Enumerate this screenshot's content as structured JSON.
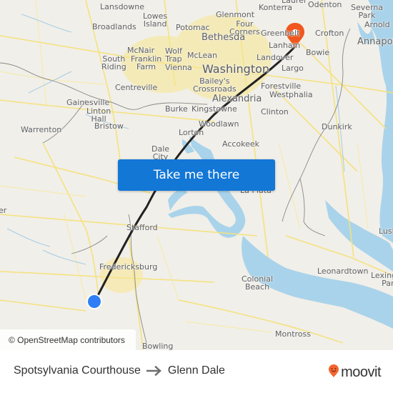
{
  "map": {
    "places": [
      {
        "name": "Lansdowne",
        "size": "normal"
      },
      {
        "name": "Broadlands",
        "size": "normal"
      },
      {
        "name": "Lowes\nIsland",
        "size": "normal"
      },
      {
        "name": "Potomac",
        "size": "normal"
      },
      {
        "name": "Glenmont",
        "size": "normal"
      },
      {
        "name": "Laurel",
        "size": "normal"
      },
      {
        "name": "Konterra",
        "size": "normal"
      },
      {
        "name": "Odenton",
        "size": "normal"
      },
      {
        "name": "Severna\nPark",
        "size": "normal"
      },
      {
        "name": "Arnold",
        "size": "normal"
      },
      {
        "name": "Annapolis",
        "size": "mid"
      },
      {
        "name": "Four\nCorners",
        "size": "normal"
      },
      {
        "name": "Bethesda",
        "size": "mid"
      },
      {
        "name": "Greenbelt",
        "size": "normal"
      },
      {
        "name": "Lanham",
        "size": "normal"
      },
      {
        "name": "Crofton",
        "size": "normal"
      },
      {
        "name": "Bowie",
        "size": "normal"
      },
      {
        "name": "McNair",
        "size": "normal"
      },
      {
        "name": "Franklin\nFarm",
        "size": "normal"
      },
      {
        "name": "Wolf\nTrap",
        "size": "normal"
      },
      {
        "name": "Vienna",
        "size": "normal"
      },
      {
        "name": "McLean",
        "size": "normal"
      },
      {
        "name": "South\nRiding",
        "size": "normal"
      },
      {
        "name": "Washington",
        "size": "big"
      },
      {
        "name": "Landover",
        "size": "normal"
      },
      {
        "name": "Largo",
        "size": "normal"
      },
      {
        "name": "Centreville",
        "size": "normal"
      },
      {
        "name": "Bailey's\nCrossroads",
        "size": "normal"
      },
      {
        "name": "Alexandria",
        "size": "mid"
      },
      {
        "name": "Forestville",
        "size": "normal"
      },
      {
        "name": "Westphalia",
        "size": "normal"
      },
      {
        "name": "Gainesville",
        "size": "normal"
      },
      {
        "name": "Linton\nHall",
        "size": "normal"
      },
      {
        "name": "Burke",
        "size": "normal"
      },
      {
        "name": "Kingstowne",
        "size": "normal"
      },
      {
        "name": "Clinton",
        "size": "normal"
      },
      {
        "name": "Warrenton",
        "size": "normal"
      },
      {
        "name": "Bristow",
        "size": "normal"
      },
      {
        "name": "Woodlawn",
        "size": "normal"
      },
      {
        "name": "Lorton",
        "size": "normal"
      },
      {
        "name": "Dunkirk",
        "size": "normal"
      },
      {
        "name": "Accokeek",
        "size": "normal"
      },
      {
        "name": "Dale\nCity",
        "size": "normal"
      },
      {
        "name": "La Plata",
        "size": "normal"
      },
      {
        "name": "Stafford",
        "size": "normal"
      },
      {
        "name": "Lusby",
        "size": "normal"
      },
      {
        "name": "Fredericksburg",
        "size": "normal"
      },
      {
        "name": "Leonardtown",
        "size": "normal"
      },
      {
        "name": "Lexington\nPark",
        "size": "normal"
      },
      {
        "name": "Colonial\nBeach",
        "size": "normal"
      },
      {
        "name": "Montross",
        "size": "normal"
      },
      {
        "name": "Bowling",
        "size": "normal"
      },
      {
        "name": "er",
        "size": "normal"
      }
    ],
    "origin_marker": {
      "label": "Spotsylvania Courthouse",
      "color": "#2f7ef5"
    },
    "destination_marker": {
      "label": "Glenn Dale",
      "color": "#f0561d"
    },
    "route_line_color": "#222222",
    "cta_label": "Take me there",
    "attribution": "© OpenStreetMap contributors"
  },
  "footer": {
    "origin": "Spotsylvania Courthouse",
    "destination": "Glenn Dale",
    "arrow_icon": "right-arrow-icon",
    "brand": "moovit",
    "brand_color": "#f26430"
  }
}
